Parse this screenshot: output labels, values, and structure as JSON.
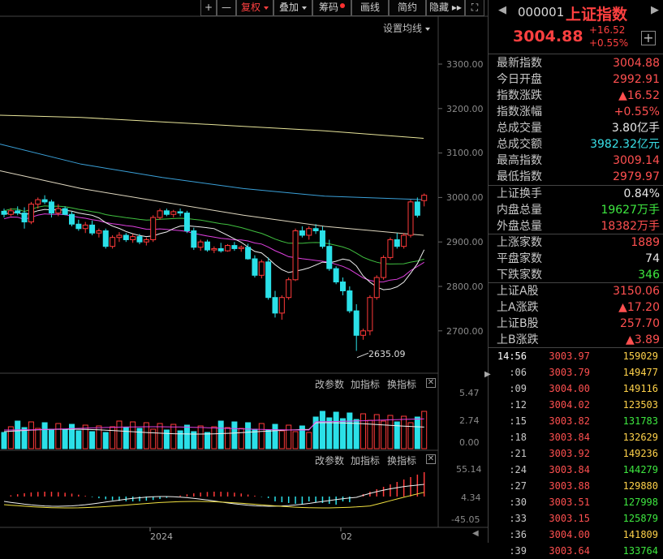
{
  "toolbar": {
    "plus": "+",
    "minus": "—",
    "fuquan": "复权",
    "diejia": "叠加",
    "chouma": "筹码",
    "huaxian": "画线",
    "jianyue": "简约",
    "yincang": "隐藏",
    "more": "▸▸",
    "expand": "⛶"
  },
  "main_chart": {
    "ma_setting_label": "设置均线",
    "y_ticks": [
      "3300.00",
      "3200.00",
      "3100.00",
      "3000.00",
      "2900.00",
      "2800.00",
      "2700.00"
    ],
    "low_marker": "2635.09"
  },
  "volume_panel": {
    "btn_params": "改参数",
    "btn_add": "加指标",
    "btn_switch": "换指标",
    "y_ticks": [
      "5.47",
      "2.74",
      "0.00"
    ]
  },
  "macd_panel": {
    "btn_params": "改参数",
    "btn_add": "加指标",
    "btn_switch": "换指标",
    "y_ticks": [
      "55.14",
      "4.34",
      "-45.05"
    ]
  },
  "x_axis": {
    "labels": [
      "2024",
      "02"
    ]
  },
  "quote": {
    "code": "000001",
    "name": "上证指数",
    "price": "3004.88",
    "change": "+16.52",
    "change_pct": "+0.55%",
    "add_icon": "+"
  },
  "stats": [
    {
      "k": "最新指数",
      "v": "3004.88",
      "c": "red"
    },
    {
      "k": "今日开盘",
      "v": "2992.91",
      "c": "red"
    },
    {
      "k": "指数涨跌",
      "v": "▲16.52",
      "c": "red"
    },
    {
      "k": "指数涨幅",
      "v": "+0.55%",
      "c": "red"
    },
    {
      "k": "总成交量",
      "v": "3.80亿手",
      "c": "wh"
    },
    {
      "k": "总成交额",
      "v": "3982.32亿元",
      "c": "cy"
    },
    {
      "k": "最高指数",
      "v": "3009.14",
      "c": "red"
    },
    {
      "k": "最低指数",
      "v": "2979.97",
      "c": "red"
    }
  ],
  "stats2": [
    {
      "k": "上证换手",
      "v": "0.84%",
      "c": "wh"
    },
    {
      "k": "内盘总量",
      "v": "19627万手",
      "c": "gr"
    },
    {
      "k": "外盘总量",
      "v": "18382万手",
      "c": "red"
    }
  ],
  "stats3": [
    {
      "k": "上涨家数",
      "v": "1889",
      "c": "red"
    },
    {
      "k": "平盘家数",
      "v": "74",
      "c": "wh"
    },
    {
      "k": "下跌家数",
      "v": "346",
      "c": "gr"
    }
  ],
  "stats4": [
    {
      "k": "上证A股",
      "v": "3150.06",
      "c": "red"
    },
    {
      "k": "上A涨跌",
      "v": "▲17.20",
      "c": "red"
    },
    {
      "k": "上证B股",
      "v": "257.70",
      "c": "red"
    },
    {
      "k": "上B涨跌",
      "v": "▲3.89",
      "c": "red"
    }
  ],
  "ticks": [
    {
      "t": "14:56",
      "p": "3003.97",
      "v": "159029",
      "g": false
    },
    {
      "t": ":06",
      "p": "3003.79",
      "v": "149477",
      "g": false
    },
    {
      "t": ":09",
      "p": "3004.00",
      "v": "149116",
      "g": false
    },
    {
      "t": ":12",
      "p": "3004.02",
      "v": "123503",
      "g": false
    },
    {
      "t": ":15",
      "p": "3003.82",
      "v": "131783",
      "g": true
    },
    {
      "t": ":18",
      "p": "3003.84",
      "v": "132629",
      "g": false
    },
    {
      "t": ":21",
      "p": "3003.92",
      "v": "149236",
      "g": false
    },
    {
      "t": ":24",
      "p": "3003.84",
      "v": "144279",
      "g": true
    },
    {
      "t": ":27",
      "p": "3003.88",
      "v": "129880",
      "g": false
    },
    {
      "t": ":30",
      "p": "3003.51",
      "v": "127998",
      "g": true
    },
    {
      "t": ":33",
      "p": "3003.15",
      "v": "125879",
      "g": true
    },
    {
      "t": ":36",
      "p": "3004.00",
      "v": "141809",
      "g": false
    },
    {
      "t": ":39",
      "p": "3003.64",
      "v": "133764",
      "g": true
    }
  ],
  "chart_data": {
    "type": "candlestick",
    "y_range": [
      2635,
      3300
    ],
    "candles": [
      [
        2969,
        2975,
        2955,
        2962
      ],
      [
        2962,
        2976,
        2958,
        2970
      ],
      [
        2970,
        2980,
        2960,
        2965
      ],
      [
        2965,
        2978,
        2930,
        2945
      ],
      [
        2945,
        2990,
        2940,
        2985
      ],
      [
        2985,
        3000,
        2975,
        2995
      ],
      [
        2995,
        3005,
        2985,
        2990
      ],
      [
        2990,
        2995,
        2955,
        2965
      ],
      [
        2965,
        2985,
        2958,
        2975
      ],
      [
        2975,
        2980,
        2960,
        2962
      ],
      [
        2962,
        2968,
        2935,
        2940
      ],
      [
        2940,
        2950,
        2925,
        2930
      ],
      [
        2930,
        2945,
        2920,
        2938
      ],
      [
        2938,
        2948,
        2915,
        2920
      ],
      [
        2920,
        2930,
        2910,
        2925
      ],
      [
        2925,
        2930,
        2885,
        2890
      ],
      [
        2890,
        2915,
        2885,
        2910
      ],
      [
        2910,
        2922,
        2900,
        2915
      ],
      [
        2915,
        2920,
        2900,
        2905
      ],
      [
        2905,
        2918,
        2898,
        2912
      ],
      [
        2912,
        2918,
        2895,
        2900
      ],
      [
        2900,
        2910,
        2892,
        2905
      ],
      [
        2905,
        2960,
        2900,
        2955
      ],
      [
        2955,
        2975,
        2950,
        2970
      ],
      [
        2970,
        2975,
        2958,
        2962
      ],
      [
        2962,
        2972,
        2955,
        2968
      ],
      [
        2968,
        2975,
        2958,
        2965
      ],
      [
        2965,
        2970,
        2920,
        2925
      ],
      [
        2925,
        2932,
        2882,
        2888
      ],
      [
        2888,
        2905,
        2880,
        2900
      ],
      [
        2900,
        2905,
        2878,
        2882
      ],
      [
        2882,
        2890,
        2875,
        2885
      ],
      [
        2885,
        2898,
        2876,
        2880
      ],
      [
        2880,
        2895,
        2878,
        2892
      ],
      [
        2892,
        2900,
        2880,
        2885
      ],
      [
        2885,
        2892,
        2878,
        2888
      ],
      [
        2888,
        2896,
        2860,
        2862
      ],
      [
        2862,
        2870,
        2820,
        2825
      ],
      [
        2825,
        2860,
        2818,
        2855
      ],
      [
        2855,
        2865,
        2770,
        2775
      ],
      [
        2775,
        2790,
        2730,
        2740
      ],
      [
        2740,
        2780,
        2725,
        2775
      ],
      [
        2775,
        2820,
        2770,
        2815
      ],
      [
        2815,
        2930,
        2812,
        2925
      ],
      [
        2925,
        2935,
        2910,
        2915
      ],
      [
        2915,
        2935,
        2905,
        2930
      ],
      [
        2930,
        2940,
        2918,
        2925
      ],
      [
        2925,
        2935,
        2885,
        2890
      ],
      [
        2890,
        2905,
        2835,
        2840
      ],
      [
        2840,
        2845,
        2805,
        2810
      ],
      [
        2810,
        2820,
        2780,
        2790
      ],
      [
        2790,
        2800,
        2740,
        2745
      ],
      [
        2745,
        2760,
        2655,
        2690
      ],
      [
        2690,
        2705,
        2680,
        2700
      ],
      [
        2700,
        2780,
        2690,
        2775
      ],
      [
        2775,
        2825,
        2770,
        2820
      ],
      [
        2820,
        2870,
        2815,
        2865
      ],
      [
        2865,
        2910,
        2860,
        2905
      ],
      [
        2905,
        2920,
        2885,
        2890
      ],
      [
        2890,
        2920,
        2885,
        2915
      ],
      [
        2915,
        2995,
        2910,
        2990
      ],
      [
        2990,
        3000,
        2955,
        2960
      ],
      [
        2993,
        3009,
        2980,
        3005
      ]
    ],
    "ma_long": [
      3185,
      3130,
      3085,
      3050,
      3010,
      2995
    ]
  }
}
